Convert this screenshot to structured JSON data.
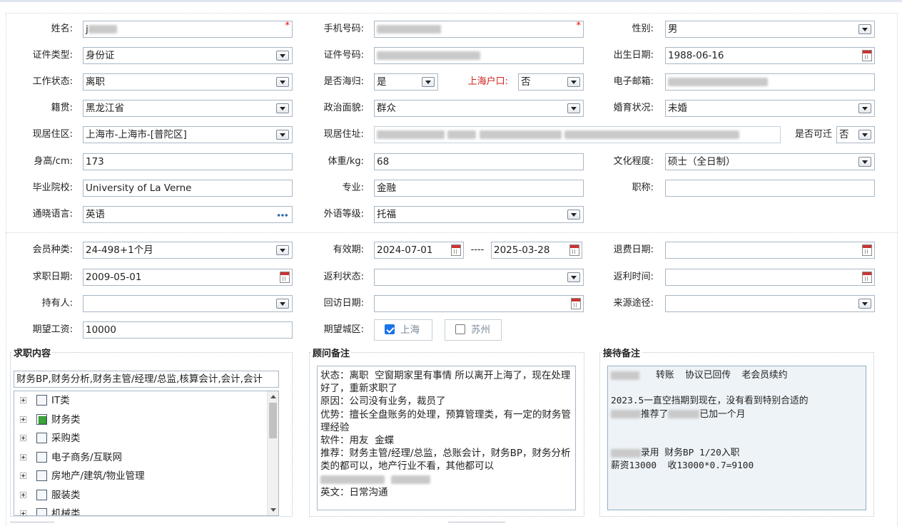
{
  "personal": {
    "name": {
      "label": "姓名:",
      "value": "j",
      "required": "*"
    },
    "mobile": {
      "label": "手机号码:",
      "required": "*"
    },
    "gender": {
      "label": "性别:",
      "value": "男"
    },
    "id_type": {
      "label": "证件类型:",
      "value": "身份证"
    },
    "id_number": {
      "label": "证件号码:"
    },
    "birthdate": {
      "label": "出生日期:",
      "value": "1988-06-16"
    },
    "work_status": {
      "label": "工作状态:",
      "value": "离职"
    },
    "returnee": {
      "label": "是否海归:",
      "value": "是"
    },
    "shanghai_hukou": {
      "label": "上海户口:",
      "value": "否"
    },
    "email": {
      "label": "电子邮箱:"
    },
    "native_place": {
      "label": "籍贯:",
      "value": "黑龙江省"
    },
    "political_status": {
      "label": "政治面貌:",
      "value": "群众"
    },
    "marital_status": {
      "label": "婚育状况:",
      "value": "未婚"
    },
    "residence_area": {
      "label": "现居住区:",
      "value": "上海市-上海市-[普陀区]"
    },
    "residence_address": {
      "label": "现居住址:"
    },
    "relocatable": {
      "label": "是否可迁",
      "value": "否"
    },
    "height": {
      "label": "身高/cm:",
      "value": "173"
    },
    "weight": {
      "label": "体重/kg:",
      "value": "68"
    },
    "education": {
      "label": "文化程度:",
      "value": "硕士（全日制）"
    },
    "school": {
      "label": "毕业院校:",
      "value": "University of La Verne"
    },
    "major": {
      "label": "专业:",
      "value": "金融"
    },
    "title": {
      "label": "职称:",
      "value": ""
    },
    "languages": {
      "label": "通晓语言:",
      "value": "英语"
    },
    "language_level": {
      "label": "外语等级:",
      "value": "托福"
    }
  },
  "membership": {
    "member_type": {
      "label": "会员种类:",
      "value": "24-498+1个月"
    },
    "validity": {
      "label": "有效期:",
      "start": "2024-07-01",
      "sep": "----",
      "end": "2025-03-28"
    },
    "refund_date": {
      "label": "退费日期:",
      "value": ""
    },
    "job_search_date": {
      "label": "求职日期:",
      "value": "2009-05-01"
    },
    "rebate_status": {
      "label": "返利状态:",
      "value": ""
    },
    "rebate_time": {
      "label": "返利时间:",
      "value": ""
    },
    "holder": {
      "label": "持有人:",
      "value": ""
    },
    "visit_date": {
      "label": "回访日期:",
      "value": ""
    },
    "source": {
      "label": "来源途径:",
      "value": ""
    },
    "expected_salary": {
      "label": "期望工资:",
      "value": "10000"
    },
    "expected_city": {
      "label": "期望城区:",
      "options": [
        {
          "label": "上海",
          "checked": true
        },
        {
          "label": "苏州",
          "checked": false
        }
      ]
    }
  },
  "job_content": {
    "legend": "求职内容",
    "selected": "财务BP,财务分析,财务主管/经理/总监,核算会计,会计,会计",
    "categories": [
      {
        "label": "IT类",
        "state": "none"
      },
      {
        "label": "财务类",
        "state": "partial"
      },
      {
        "label": "采购类",
        "state": "none"
      },
      {
        "label": "电子商务/互联网",
        "state": "none"
      },
      {
        "label": "房地产/建筑/物业管理",
        "state": "none"
      },
      {
        "label": "服装类",
        "state": "none"
      },
      {
        "label": "机械类",
        "state": "none"
      }
    ]
  },
  "consultant_notes": {
    "legend": "顾问备注",
    "lines": [
      "状态：离职  空窗期家里有事情 所以离开上海了，现在处理好了，重新求职了",
      "原因：公司没有业务，裁员了",
      "优势：擅长全盘账务的处理，预算管理类，有一定的财务管理经验",
      "软件：用友  金蝶",
      "推荐：财务主管/经理/总监，总账会计，财务BP，财务分析类的都可以，地产行业不看，其他都可以",
      "英文：日常沟通"
    ]
  },
  "reception_notes": {
    "legend": "接待备注",
    "l1": "转账  协议已回传  老会员续约",
    "l2": "2023.5一直空挡期到现在，没有看到特别合适的",
    "l3a": "推荐了",
    "l3b": "已加一个月",
    "l4": "录用 财务BP 1/20入职",
    "l5": "薪资13000  收13000*0.7=9100"
  }
}
